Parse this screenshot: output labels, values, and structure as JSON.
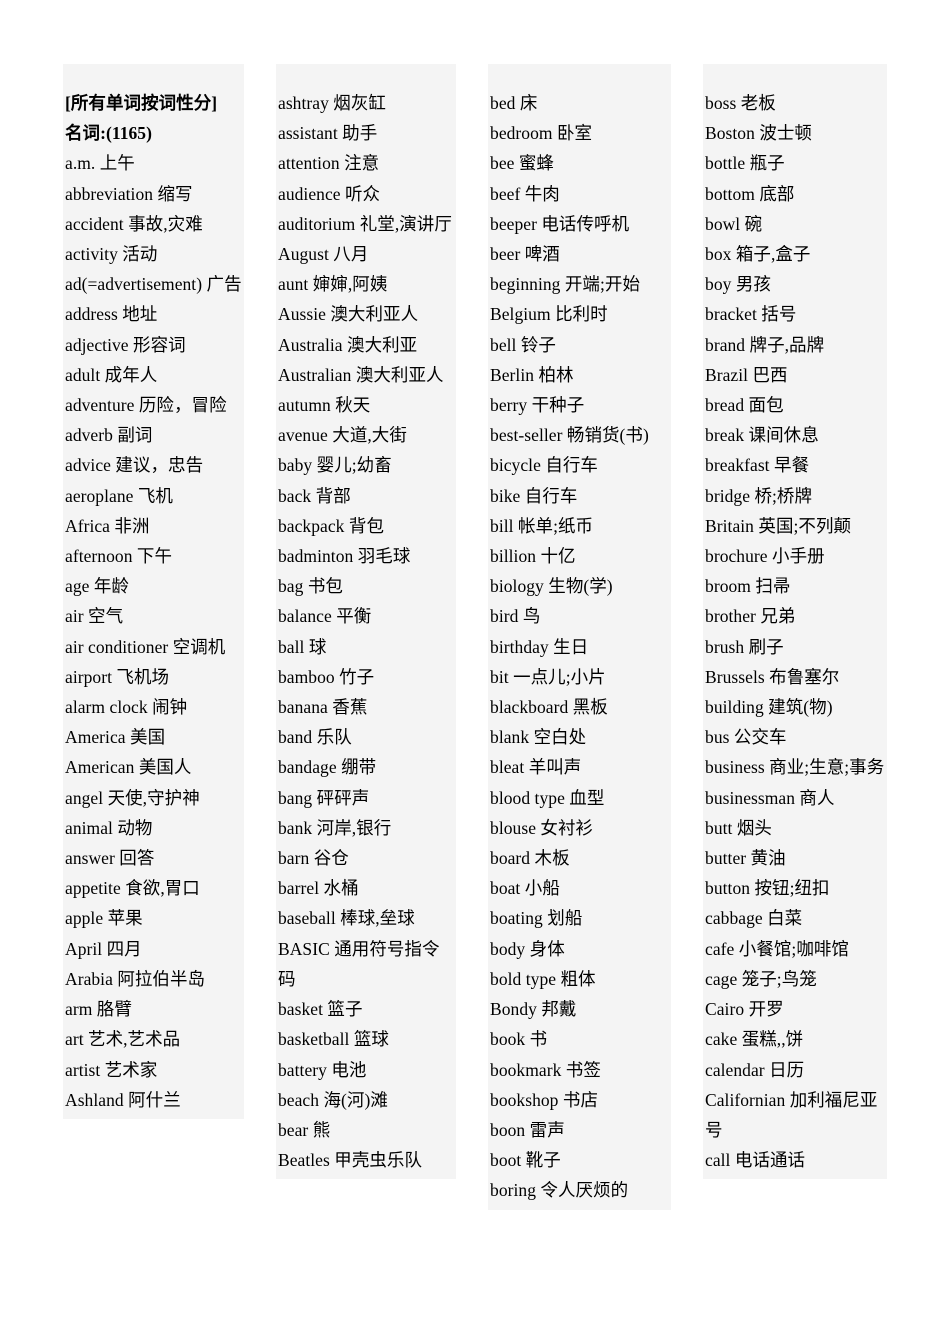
{
  "document": {
    "background_color": "#ffffff",
    "column_background_color": "#f4f4f4",
    "text_color": "#000000",
    "title": "[所有单词按词性分]",
    "section_heading": "名词:(1165)"
  },
  "columns": [
    {
      "id": "column-1",
      "has_heading": true,
      "heading_lines": [
        "[所有单词按词性分]",
        "名词:(1165)"
      ],
      "entries": [
        "a.m. 上午",
        "abbreviation 缩写",
        "accident 事故,灾难",
        "activity 活动",
        "ad(=advertisement) 广告",
        "address 地址",
        "adjective 形容词",
        "adult 成年人",
        "adventure 历险，冒险",
        "adverb 副词",
        "advice 建议，忠告",
        "aeroplane 飞机",
        "Africa 非洲",
        "afternoon 下午",
        "age 年龄",
        "air 空气",
        "air conditioner 空调机",
        "airport 飞机场",
        "alarm clock 闹钟",
        "America 美国",
        "American 美国人",
        "angel 天使,守护神",
        "animal 动物",
        "answer 回答",
        "appetite 食欲,胃口",
        "apple 苹果",
        "April 四月",
        "Arabia 阿拉伯半岛",
        "arm 胳臂",
        "art 艺术,艺术品",
        "artist 艺术家",
        "Ashland 阿什兰"
      ]
    },
    {
      "id": "column-2",
      "has_heading": false,
      "heading_lines": [],
      "entries": [
        "ashtray 烟灰缸",
        "assistant 助手",
        "attention 注意",
        "audience 听众",
        "auditorium 礼堂,演讲厅",
        "August 八月",
        "aunt 婶婶,阿姨",
        "Aussie 澳大利亚人",
        "Australia 澳大利亚",
        "Australian 澳大利亚人",
        "autumn 秋天",
        "avenue 大道,大街",
        "baby 婴儿;幼畜",
        "back 背部",
        "backpack 背包",
        "badminton 羽毛球",
        "bag 书包",
        "balance 平衡",
        "ball 球",
        "bamboo 竹子",
        "banana 香蕉",
        "band 乐队",
        "bandage 绷带",
        "bang 砰砰声",
        "bank 河岸,银行",
        "barn 谷仓",
        "barrel 水桶",
        "baseball 棒球,垒球",
        "BASIC 通用符号指令码",
        "basket 篮子",
        "basketball 篮球",
        "battery 电池",
        "beach  海(河)滩",
        "bear 熊",
        "Beatles 甲壳虫乐队"
      ]
    },
    {
      "id": "column-3",
      "has_heading": false,
      "heading_lines": [],
      "entries": [
        "bed 床",
        "bedroom 卧室",
        "bee 蜜蜂",
        "beef 牛肉",
        "beeper 电话传呼机",
        "beer 啤酒",
        "beginning 开端;开始",
        "Belgium 比利时",
        "bell 铃子",
        "Berlin 柏林",
        "berry 干种子",
        "best-seller 畅销货(书)",
        "bicycle 自行车",
        "bike 自行车",
        "bill 帐单;纸币",
        "billion 十亿",
        "biology 生物(学)",
        "bird 鸟",
        "birthday 生日",
        "bit  一点儿;小片",
        "blackboard 黑板",
        "blank 空白处",
        "bleat 羊叫声",
        "blood type 血型",
        "blouse 女衬衫",
        "board 木板",
        "boat 小船",
        "boating 划船",
        "body 身体",
        "bold type 粗体",
        "Bondy 邦戴",
        "book 书",
        "bookmark 书签",
        "bookshop 书店",
        "boon 雷声",
        "boot 靴子",
        "boring 令人厌烦的"
      ]
    },
    {
      "id": "column-4",
      "has_heading": false,
      "heading_lines": [],
      "entries": [
        "boss 老板",
        "Boston 波士顿",
        "bottle 瓶子",
        "bottom 底部",
        "bowl 碗",
        "box 箱子,盒子",
        "boy 男孩",
        "bracket 括号",
        "brand  牌子,品牌",
        "Brazil 巴西",
        "bread 面包",
        "break 课间休息",
        "breakfast 早餐",
        "bridge 桥;桥牌",
        "Britain 英国;不列颠",
        "brochure 小手册",
        "broom 扫帚",
        "brother 兄弟",
        "brush 刷子",
        "Brussels 布鲁塞尔",
        "building 建筑(物)",
        "bus 公交车",
        "business 商业;生意;事务",
        "businessman 商人",
        "butt 烟头",
        "butter 黄油",
        "button 按钮;纽扣",
        "cabbage 白菜",
        "cafe 小餐馆;咖啡馆",
        "cage 笼子;鸟笼",
        "Cairo 开罗",
        "cake 蛋糕,,饼",
        "calendar 日历",
        "Californian 加利福尼亚号",
        "call 电话通话"
      ]
    }
  ]
}
